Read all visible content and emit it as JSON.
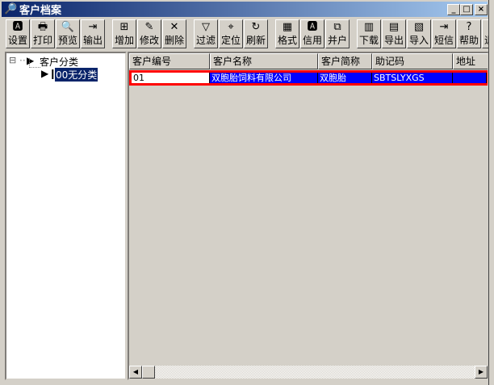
{
  "window": {
    "title": "客户档案",
    "min": "_",
    "max": "□",
    "close": "×"
  },
  "toolbar": [
    {
      "label": "设置",
      "icon": "page-setup-icon",
      "glyph": "🅰"
    },
    {
      "label": "打印",
      "icon": "printer-icon",
      "glyph": "🖶"
    },
    {
      "label": "预览",
      "icon": "preview-icon",
      "glyph": "🔍"
    },
    {
      "label": "输出",
      "icon": "output-icon",
      "glyph": "⇥"
    },
    {
      "label": "增加",
      "icon": "add-icon",
      "glyph": "⊞"
    },
    {
      "label": "修改",
      "icon": "edit-icon",
      "glyph": "✎"
    },
    {
      "label": "删除",
      "icon": "delete-icon",
      "glyph": "✕"
    },
    {
      "label": "过滤",
      "icon": "filter-icon",
      "glyph": "▽"
    },
    {
      "label": "定位",
      "icon": "locate-icon",
      "glyph": "⌖"
    },
    {
      "label": "刷新",
      "icon": "refresh-icon",
      "glyph": "↻"
    },
    {
      "label": "格式",
      "icon": "format-icon",
      "glyph": "▦"
    },
    {
      "label": "信用",
      "icon": "credit-icon",
      "glyph": "🅰"
    },
    {
      "label": "并户",
      "icon": "merge-icon",
      "glyph": "⧉"
    },
    {
      "label": "下载",
      "icon": "download-icon",
      "glyph": "▥"
    },
    {
      "label": "导出",
      "icon": "export-icon",
      "glyph": "▤"
    },
    {
      "label": "导入",
      "icon": "import-icon",
      "glyph": "▧"
    },
    {
      "label": "短信",
      "icon": "sms-icon",
      "glyph": "⇥"
    },
    {
      "label": "帮助",
      "icon": "help-icon",
      "glyph": "?"
    },
    {
      "label": "退出",
      "icon": "exit-icon",
      "glyph": "↳"
    }
  ],
  "tree": {
    "root": "客户分类",
    "child": "00无分类",
    "expander": "⊟"
  },
  "grid": {
    "columns": [
      "客户编号",
      "客户名称",
      "客户简称",
      "助记码",
      "地址"
    ],
    "rows": [
      [
        "01",
        "双胞胎饲料有限公司",
        "双胞胎",
        "SBTSLYXGS",
        ""
      ]
    ]
  }
}
